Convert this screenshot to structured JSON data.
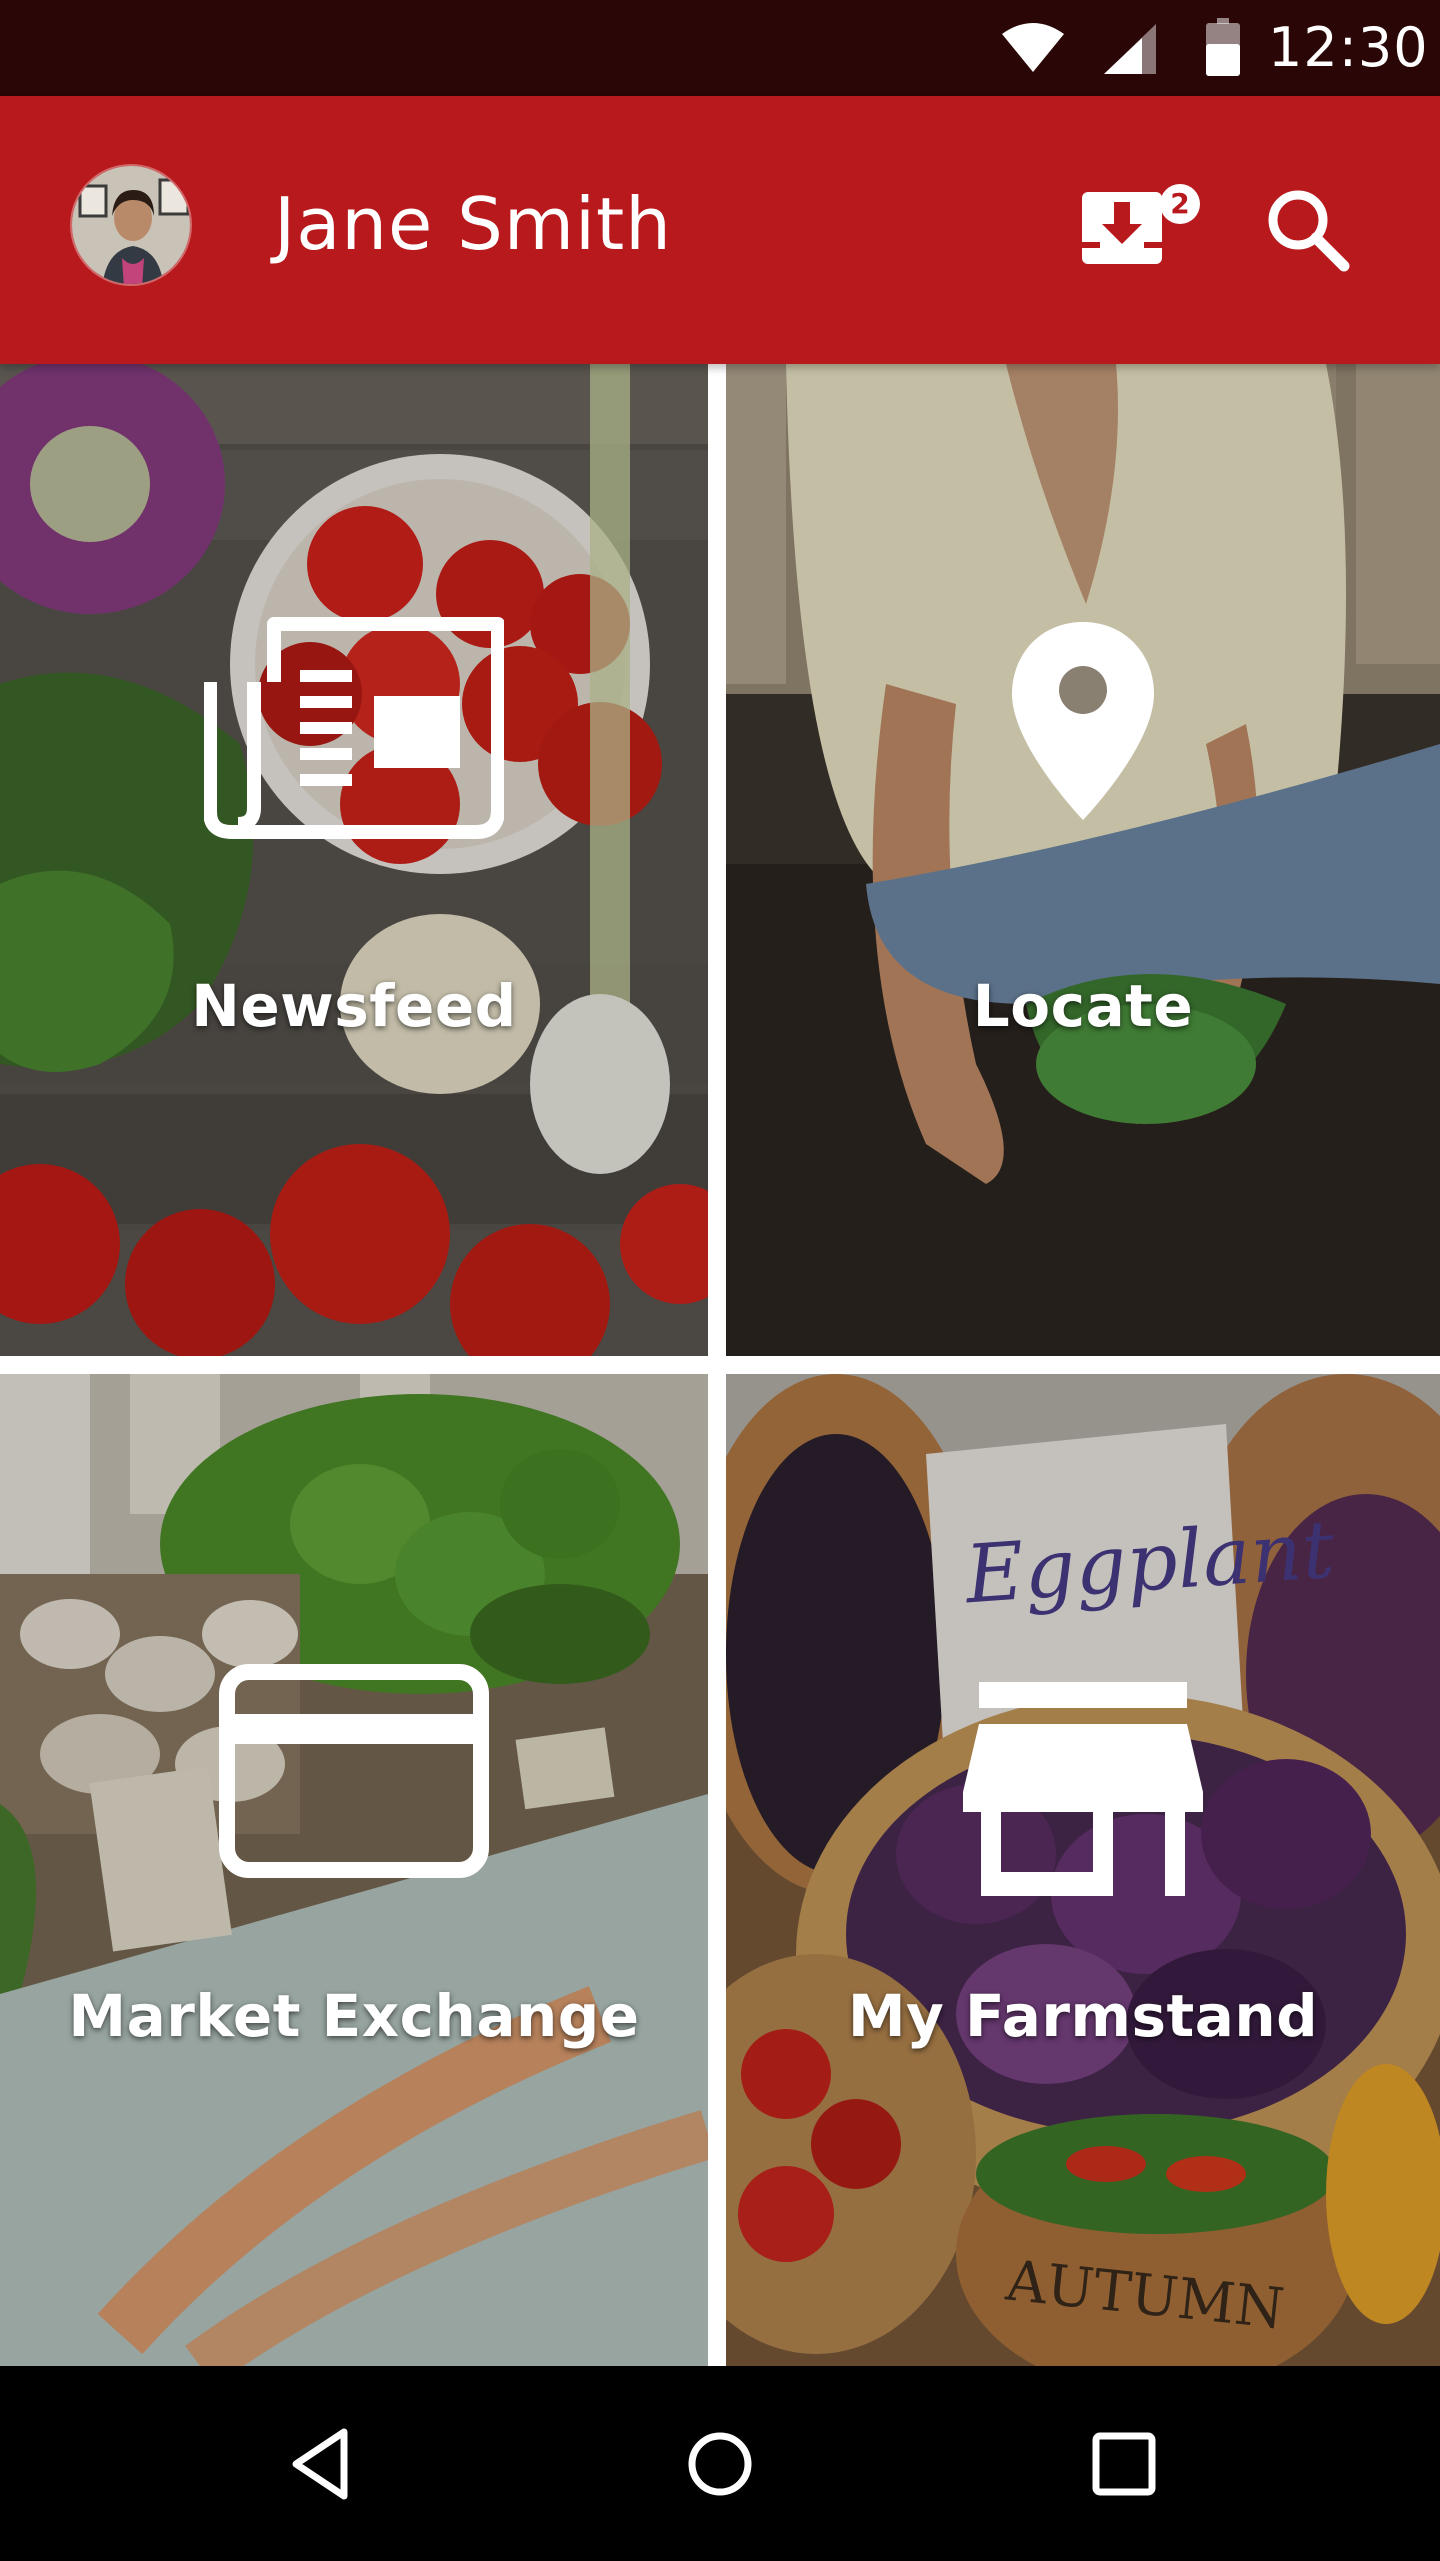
{
  "status_bar": {
    "time": "12:30",
    "icons": [
      "wifi-icon",
      "cell-signal-icon",
      "battery-icon"
    ]
  },
  "app_bar": {
    "user_name": "Jane Smith",
    "avatar_icon": "user-avatar",
    "downloads_icon": "download-tray-icon",
    "downloads_badge": "2",
    "search_icon": "search-icon",
    "color": "#b8191c"
  },
  "tiles": [
    {
      "label": "Newsfeed",
      "icon": "newspaper-icon"
    },
    {
      "label": "Locate",
      "icon": "map-pin-icon"
    },
    {
      "label": "Market Exchange",
      "icon": "credit-card-icon"
    },
    {
      "label": "My Farmstand",
      "icon": "storefront-icon"
    }
  ],
  "nav_bar": {
    "icons": [
      "back-icon",
      "home-icon",
      "recents-icon"
    ]
  }
}
